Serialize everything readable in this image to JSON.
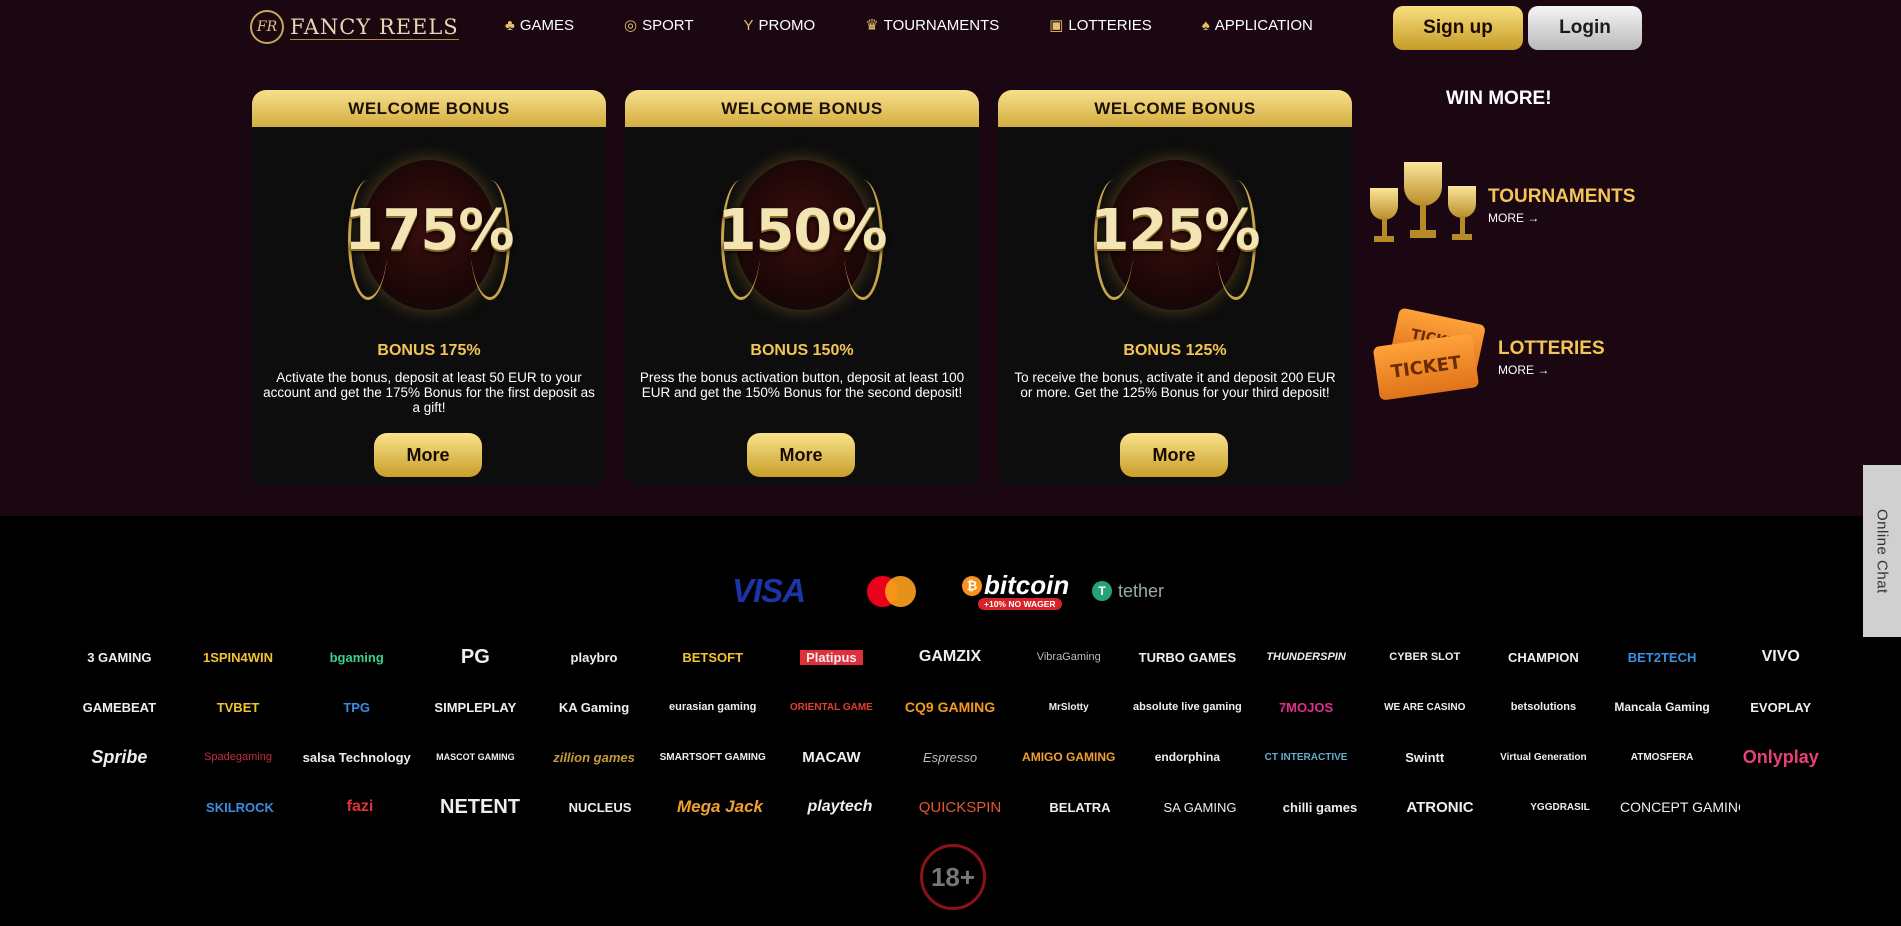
{
  "header": {
    "logo_mark": "FR",
    "logo_text": "FANCY REELS",
    "nav": [
      {
        "label": "GAMES",
        "icon": "gamepad-icon",
        "glyph": "♣"
      },
      {
        "label": "SPORT",
        "icon": "medal-icon",
        "glyph": "⚽"
      },
      {
        "label": "PROMO",
        "icon": "cocktail-icon",
        "glyph": "🍸"
      },
      {
        "label": "TOURNAMENTS",
        "icon": "crown-icon",
        "glyph": "♛"
      },
      {
        "label": "LOTTERIES",
        "icon": "gift-icon",
        "glyph": "🎁"
      },
      {
        "label": "APPLICATION",
        "icon": "ice-cream-icon",
        "glyph": "🍦"
      }
    ],
    "signup": "Sign up",
    "login": "Login"
  },
  "bonuses": [
    {
      "header": "WELCOME BONUS",
      "percent": "175%",
      "title": "BONUS 175%",
      "description": "Activate the bonus, deposit at least 50 EUR to your account and get the 175% Bonus for the first deposit as a gift!",
      "button": "More"
    },
    {
      "header": "WELCOME BONUS",
      "percent": "150%",
      "title": "BONUS 150%",
      "description": "Press the bonus activation button, deposit at least 100 EUR and get the 150% Bonus for the second deposit!",
      "button": "More"
    },
    {
      "header": "WELCOME BONUS",
      "percent": "125%",
      "title": "BONUS 125%",
      "description": "To receive the bonus, activate it and deposit 200 EUR or more. Get the 125% Bonus for your third deposit!",
      "button": "More"
    }
  ],
  "win_more": {
    "title": "WIN MORE!",
    "items": [
      {
        "label": "TOURNAMENTS",
        "more": "MORE →"
      },
      {
        "label": "LOTTERIES",
        "more": "MORE →",
        "ticket_text": "TICKET"
      }
    ]
  },
  "payments": {
    "visa": "VISA",
    "bitcoin": "bitcoin",
    "bitcoin_tag": "+10% NO WAGER",
    "tether": "tether",
    "colors": {
      "visa": "#1b35a8",
      "mc_red": "#eb001b",
      "mc_orange": "#f79e1b",
      "btc": "#f7931a",
      "tether": "#26a17b"
    }
  },
  "providers": [
    [
      "3 GAMING",
      "1SPIN4WIN",
      "bgaming",
      "PG",
      "playbro",
      "BETSOFT",
      "Platipus",
      "GAMZIX",
      "VibraGaming",
      "TURBO GAMES",
      "THUNDERSPIN",
      "CYBER SLOT",
      "CHAMPION",
      "BET2TECH",
      "VIVO"
    ],
    [
      "GAMEBEAT",
      "TVBET",
      "TPG",
      "SIMPLEPLAY",
      "KA Gaming",
      "eurasian gaming",
      "ORIENTAL GAME",
      "CQ9 GAMING",
      "MrSlotty",
      "absolute live gaming",
      "7MOJOS",
      "WE ARE CASINO",
      "betsolutions",
      "Mancala Gaming",
      "EVOPLAY"
    ],
    [
      "Spribe",
      "Spadegaming",
      "salsa Technology",
      "MASCOT GAMING",
      "zillion games",
      "SMARTSOFT GAMING",
      "MACAW",
      "Espresso",
      "AMIGO GAMING",
      "endorphina",
      "CT INTERACTIVE",
      "Swintt",
      "Virtual Generation",
      "ATMOSFERA",
      "Onlyplay"
    ],
    [
      "SKILROCK",
      "fazi",
      "NETENT",
      "NUCLEUS",
      "Mega Jack",
      "playtech",
      "QUICKSPIN",
      "BELATRA",
      "SA GAMING",
      "chilli games",
      "ATRONIC",
      "YGGDRASIL",
      "CONCEPT GAMING"
    ]
  ],
  "age": "18+",
  "chat": "Online Chat"
}
